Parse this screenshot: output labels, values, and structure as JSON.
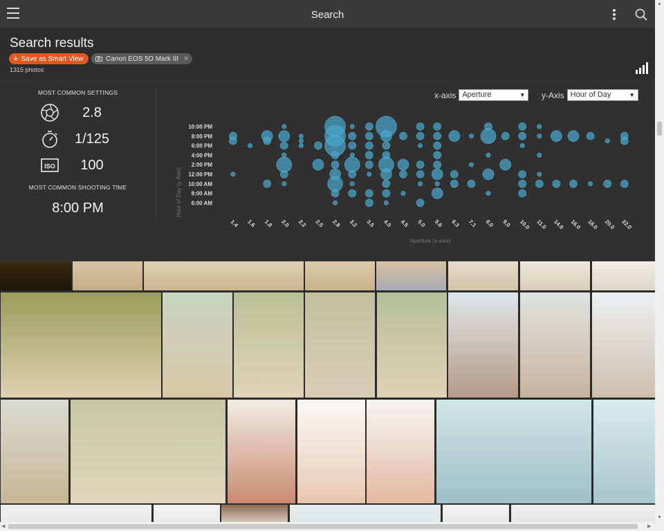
{
  "topbar": {
    "title": "Search"
  },
  "header": {
    "title": "Search results",
    "smart_view_label": "Save as Smart View",
    "filter_chip": "Canon EOS 5D Mark III",
    "photo_count": "1315 photos"
  },
  "stats": {
    "common_settings_label": "MOST COMMON SETTINGS",
    "aperture": "2.8",
    "shutter": "1/125",
    "iso": "100",
    "common_time_label": "MOST COMMON SHOOTING TIME",
    "shooting_time": "8:00 PM",
    "xaxis_label": "x-axis",
    "xaxis_value": "Aperture",
    "yaxis_label": "y-Axis",
    "yaxis_value": "Hour of Day"
  },
  "chart_data": {
    "type": "scatter",
    "xlabel": "Aperture (x-axis)",
    "ylabel": "Hour of Day (y-Axis)",
    "x_categories": [
      "1.4",
      "1.6",
      "1.8",
      "2.0",
      "2.2",
      "2.5",
      "2.8",
      "3.2",
      "3.5",
      "4.0",
      "4.5",
      "5.0",
      "5.6",
      "6.3",
      "7.1",
      "8.0",
      "9.0",
      "10.0",
      "11.0",
      "14.0",
      "16.0",
      "18.0",
      "20.0",
      "22.0"
    ],
    "y_ticks": [
      "10:00 PM",
      "8:00 PM",
      "6:00 PM",
      "4:00 PM",
      "2:00 PM",
      "12:00 PM",
      "10:00 AM",
      "8:00 AM",
      "6:00 AM"
    ],
    "points": [
      {
        "x": "1.4",
        "y": "8:00 PM",
        "size": 2
      },
      {
        "x": "1.4",
        "y": "7:00 PM",
        "size": 2
      },
      {
        "x": "1.4",
        "y": "12:00 PM",
        "size": 1
      },
      {
        "x": "1.6",
        "y": "6:00 PM",
        "size": 1
      },
      {
        "x": "1.8",
        "y": "8:00 PM",
        "size": 3
      },
      {
        "x": "1.8",
        "y": "7:00 PM",
        "size": 2
      },
      {
        "x": "1.8",
        "y": "10:00 AM",
        "size": 2
      },
      {
        "x": "2.0",
        "y": "10:00 PM",
        "size": 1
      },
      {
        "x": "2.0",
        "y": "8:00 PM",
        "size": 3
      },
      {
        "x": "2.0",
        "y": "6:00 PM",
        "size": 2
      },
      {
        "x": "2.0",
        "y": "4:00 PM",
        "size": 1
      },
      {
        "x": "2.0",
        "y": "2:00 PM",
        "size": 4
      },
      {
        "x": "2.0",
        "y": "12:00 PM",
        "size": 2
      },
      {
        "x": "2.0",
        "y": "10:00 AM",
        "size": 1
      },
      {
        "x": "2.2",
        "y": "8:00 PM",
        "size": 1
      },
      {
        "x": "2.2",
        "y": "7:00 PM",
        "size": 1
      },
      {
        "x": "2.2",
        "y": "6:00 PM",
        "size": 1
      },
      {
        "x": "2.5",
        "y": "6:00 PM",
        "size": 2
      },
      {
        "x": "2.5",
        "y": "2:00 PM",
        "size": 3
      },
      {
        "x": "2.8",
        "y": "10:00 PM",
        "size": 5
      },
      {
        "x": "2.8",
        "y": "8:00 PM",
        "size": 5
      },
      {
        "x": "2.8",
        "y": "6:00 PM",
        "size": 5
      },
      {
        "x": "2.8",
        "y": "4:00 PM",
        "size": 2
      },
      {
        "x": "2.8",
        "y": "2:00 PM",
        "size": 2
      },
      {
        "x": "2.8",
        "y": "12:00 PM",
        "size": 3
      },
      {
        "x": "2.8",
        "y": "10:00 AM",
        "size": 4
      },
      {
        "x": "2.8",
        "y": "8:00 AM",
        "size": 2
      },
      {
        "x": "2.8",
        "y": "6:00 AM",
        "size": 1
      },
      {
        "x": "3.2",
        "y": "10:00 PM",
        "size": 1
      },
      {
        "x": "3.2",
        "y": "8:00 PM",
        "size": 2
      },
      {
        "x": "3.2",
        "y": "6:00 PM",
        "size": 2
      },
      {
        "x": "3.2",
        "y": "4:00 PM",
        "size": 1
      },
      {
        "x": "3.2",
        "y": "2:00 PM",
        "size": 4
      },
      {
        "x": "3.2",
        "y": "12:00 PM",
        "size": 2
      },
      {
        "x": "3.2",
        "y": "10:00 AM",
        "size": 1
      },
      {
        "x": "3.2",
        "y": "8:00 AM",
        "size": 2
      },
      {
        "x": "3.5",
        "y": "10:00 PM",
        "size": 2
      },
      {
        "x": "3.5",
        "y": "8:00 PM",
        "size": 2
      },
      {
        "x": "3.5",
        "y": "6:00 PM",
        "size": 2
      },
      {
        "x": "3.5",
        "y": "4:00 PM",
        "size": 2
      },
      {
        "x": "3.5",
        "y": "2:00 PM",
        "size": 2
      },
      {
        "x": "3.5",
        "y": "12:00 PM",
        "size": 1
      },
      {
        "x": "3.5",
        "y": "8:00 AM",
        "size": 2
      },
      {
        "x": "3.5",
        "y": "6:00 AM",
        "size": 2
      },
      {
        "x": "4.0",
        "y": "10:00 PM",
        "size": 5
      },
      {
        "x": "4.0",
        "y": "8:00 PM",
        "size": 3
      },
      {
        "x": "4.0",
        "y": "6:00 PM",
        "size": 2
      },
      {
        "x": "4.0",
        "y": "4:00 PM",
        "size": 2
      },
      {
        "x": "4.0",
        "y": "2:00 PM",
        "size": 4
      },
      {
        "x": "4.0",
        "y": "12:00 PM",
        "size": 3
      },
      {
        "x": "4.0",
        "y": "10:00 AM",
        "size": 2
      },
      {
        "x": "4.0",
        "y": "8:00 AM",
        "size": 2
      },
      {
        "x": "4.0",
        "y": "6:00 AM",
        "size": 1
      },
      {
        "x": "4.5",
        "y": "8:00 PM",
        "size": 2
      },
      {
        "x": "4.5",
        "y": "2:00 PM",
        "size": 3
      },
      {
        "x": "4.5",
        "y": "12:00 PM",
        "size": 2
      },
      {
        "x": "4.5",
        "y": "8:00 AM",
        "size": 1
      },
      {
        "x": "5.0",
        "y": "10:00 PM",
        "size": 2
      },
      {
        "x": "5.0",
        "y": "8:00 PM",
        "size": 2
      },
      {
        "x": "5.0",
        "y": "6:00 PM",
        "size": 1
      },
      {
        "x": "5.0",
        "y": "2:00 PM",
        "size": 2
      },
      {
        "x": "5.0",
        "y": "12:00 PM",
        "size": 2
      },
      {
        "x": "5.0",
        "y": "10:00 AM",
        "size": 1
      },
      {
        "x": "5.0",
        "y": "6:00 AM",
        "size": 2
      },
      {
        "x": "5.6",
        "y": "10:00 PM",
        "size": 2
      },
      {
        "x": "5.6",
        "y": "8:00 PM",
        "size": 2
      },
      {
        "x": "5.6",
        "y": "6:00 PM",
        "size": 2
      },
      {
        "x": "5.6",
        "y": "4:00 PM",
        "size": 2
      },
      {
        "x": "5.6",
        "y": "2:00 PM",
        "size": 2
      },
      {
        "x": "5.6",
        "y": "12:00 PM",
        "size": 3
      },
      {
        "x": "5.6",
        "y": "10:00 AM",
        "size": 1
      },
      {
        "x": "5.6",
        "y": "8:00 AM",
        "size": 3
      },
      {
        "x": "6.3",
        "y": "8:00 PM",
        "size": 3
      },
      {
        "x": "6.3",
        "y": "12:00 PM",
        "size": 2
      },
      {
        "x": "6.3",
        "y": "10:00 AM",
        "size": 2
      },
      {
        "x": "7.1",
        "y": "8:00 PM",
        "size": 1
      },
      {
        "x": "7.1",
        "y": "2:00 PM",
        "size": 1
      },
      {
        "x": "7.1",
        "y": "10:00 AM",
        "size": 2
      },
      {
        "x": "8.0",
        "y": "10:00 PM",
        "size": 2
      },
      {
        "x": "8.0",
        "y": "8:00 PM",
        "size": 4
      },
      {
        "x": "8.0",
        "y": "4:00 PM",
        "size": 1
      },
      {
        "x": "8.0",
        "y": "12:00 PM",
        "size": 3
      },
      {
        "x": "8.0",
        "y": "8:00 AM",
        "size": 1
      },
      {
        "x": "9.0",
        "y": "8:00 PM",
        "size": 2
      },
      {
        "x": "9.0",
        "y": "2:00 PM",
        "size": 3
      },
      {
        "x": "10.0",
        "y": "10:00 PM",
        "size": 2
      },
      {
        "x": "10.0",
        "y": "8:00 PM",
        "size": 2
      },
      {
        "x": "10.0",
        "y": "6:00 PM",
        "size": 1
      },
      {
        "x": "10.0",
        "y": "12:00 PM",
        "size": 2
      },
      {
        "x": "10.0",
        "y": "10:00 AM",
        "size": 2
      },
      {
        "x": "10.0",
        "y": "8:00 AM",
        "size": 2
      },
      {
        "x": "11.0",
        "y": "10:00 PM",
        "size": 1
      },
      {
        "x": "11.0",
        "y": "8:00 PM",
        "size": 1
      },
      {
        "x": "11.0",
        "y": "4:00 PM",
        "size": 1
      },
      {
        "x": "11.0",
        "y": "12:00 PM",
        "size": 1
      },
      {
        "x": "11.0",
        "y": "10:00 AM",
        "size": 2
      },
      {
        "x": "14.0",
        "y": "8:00 PM",
        "size": 3
      },
      {
        "x": "14.0",
        "y": "10:00 AM",
        "size": 2
      },
      {
        "x": "16.0",
        "y": "8:00 PM",
        "size": 3
      },
      {
        "x": "16.0",
        "y": "10:00 AM",
        "size": 2
      },
      {
        "x": "18.0",
        "y": "8:00 PM",
        "size": 2
      },
      {
        "x": "18.0",
        "y": "10:00 AM",
        "size": 1
      },
      {
        "x": "20.0",
        "y": "7:00 PM",
        "size": 1
      },
      {
        "x": "20.0",
        "y": "10:00 AM",
        "size": 2
      },
      {
        "x": "22.0",
        "y": "8:00 PM",
        "size": 2
      },
      {
        "x": "22.0",
        "y": "7:00 PM",
        "size": 2
      },
      {
        "x": "22.0",
        "y": "10:00 AM",
        "size": 2
      }
    ]
  },
  "colors": {
    "accent": "#e1571c",
    "bubble": "#4aa6cc",
    "panel": "#303030",
    "topbar": "#3a3a3a"
  },
  "photos": [
    {
      "label": "photo-1",
      "c1": "#3a2a10",
      "c2": "#1e1608"
    },
    {
      "label": "photo-2",
      "c1": "#d8c4a4",
      "c2": "#c7ae88"
    },
    {
      "label": "photo-3",
      "c1": "#e0cfb4",
      "c2": "#cbb592"
    },
    {
      "label": "photo-4",
      "c1": "#dccaa8",
      "c2": "#c9b28c"
    },
    {
      "label": "photo-5",
      "c1": "#d6c1a0",
      "c2": "#a9a9b5"
    },
    {
      "label": "photo-6",
      "c1": "#e8dccb",
      "c2": "#d2c2a6"
    },
    {
      "label": "photo-7",
      "c1": "#efe8dc",
      "c2": "#d9cdb8"
    },
    {
      "label": "photo-8",
      "c1": "#f1ede6",
      "c2": "#ddd6c8"
    },
    {
      "label": "photo-9",
      "c1": "#9a9c5a",
      "c2": "#e0d0b0"
    },
    {
      "label": "photo-10",
      "c1": "#c9d4c0",
      "c2": "#d8c8a8"
    },
    {
      "label": "photo-11",
      "c1": "#b8c098",
      "c2": "#e2d3b8"
    },
    {
      "label": "photo-12",
      "c1": "#c0c0a0",
      "c2": "#dacdb5"
    },
    {
      "label": "photo-13",
      "c1": "#b5bf9a",
      "c2": "#e0d2b5"
    },
    {
      "label": "photo-14",
      "c1": "#dfe6ea",
      "c2": "#b59a86"
    },
    {
      "label": "photo-15",
      "c1": "#dfe3e2",
      "c2": "#c8b39c"
    },
    {
      "label": "photo-16",
      "c1": "#ecf0f2",
      "c2": "#cdbfae"
    },
    {
      "label": "photo-17",
      "c1": "#d8dcd0",
      "c2": "#c9b595"
    },
    {
      "label": "photo-18",
      "c1": "#c4c8a4",
      "c2": "#e2d6bc"
    },
    {
      "label": "photo-19",
      "c1": "#f2ece4",
      "c2": "#c98a70"
    },
    {
      "label": "photo-20",
      "c1": "#fafafa",
      "c2": "#e9c7b0"
    },
    {
      "label": "photo-21",
      "c1": "#f5f5f5",
      "c2": "#e4b8a0"
    },
    {
      "label": "photo-22",
      "c1": "#cfe6e8",
      "c2": "#9fbfc8"
    },
    {
      "label": "photo-23",
      "c1": "#d8ecee",
      "c2": "#a8c6cc"
    },
    {
      "label": "photo-24",
      "c1": "#f0f0f0",
      "c2": "#e6e6e6"
    },
    {
      "label": "photo-25",
      "c1": "#f2f2f2",
      "c2": "#e8e8e8"
    },
    {
      "label": "photo-26",
      "c1": "#8a6a50",
      "c2": "#e6dcd2"
    },
    {
      "label": "photo-27",
      "c1": "#e8eeee",
      "c2": "#dde5e5"
    },
    {
      "label": "photo-28",
      "c1": "#f4f4f4",
      "c2": "#e6e6e6"
    },
    {
      "label": "photo-29",
      "c1": "#f0f0f0",
      "c2": "#e3e3e3"
    }
  ]
}
